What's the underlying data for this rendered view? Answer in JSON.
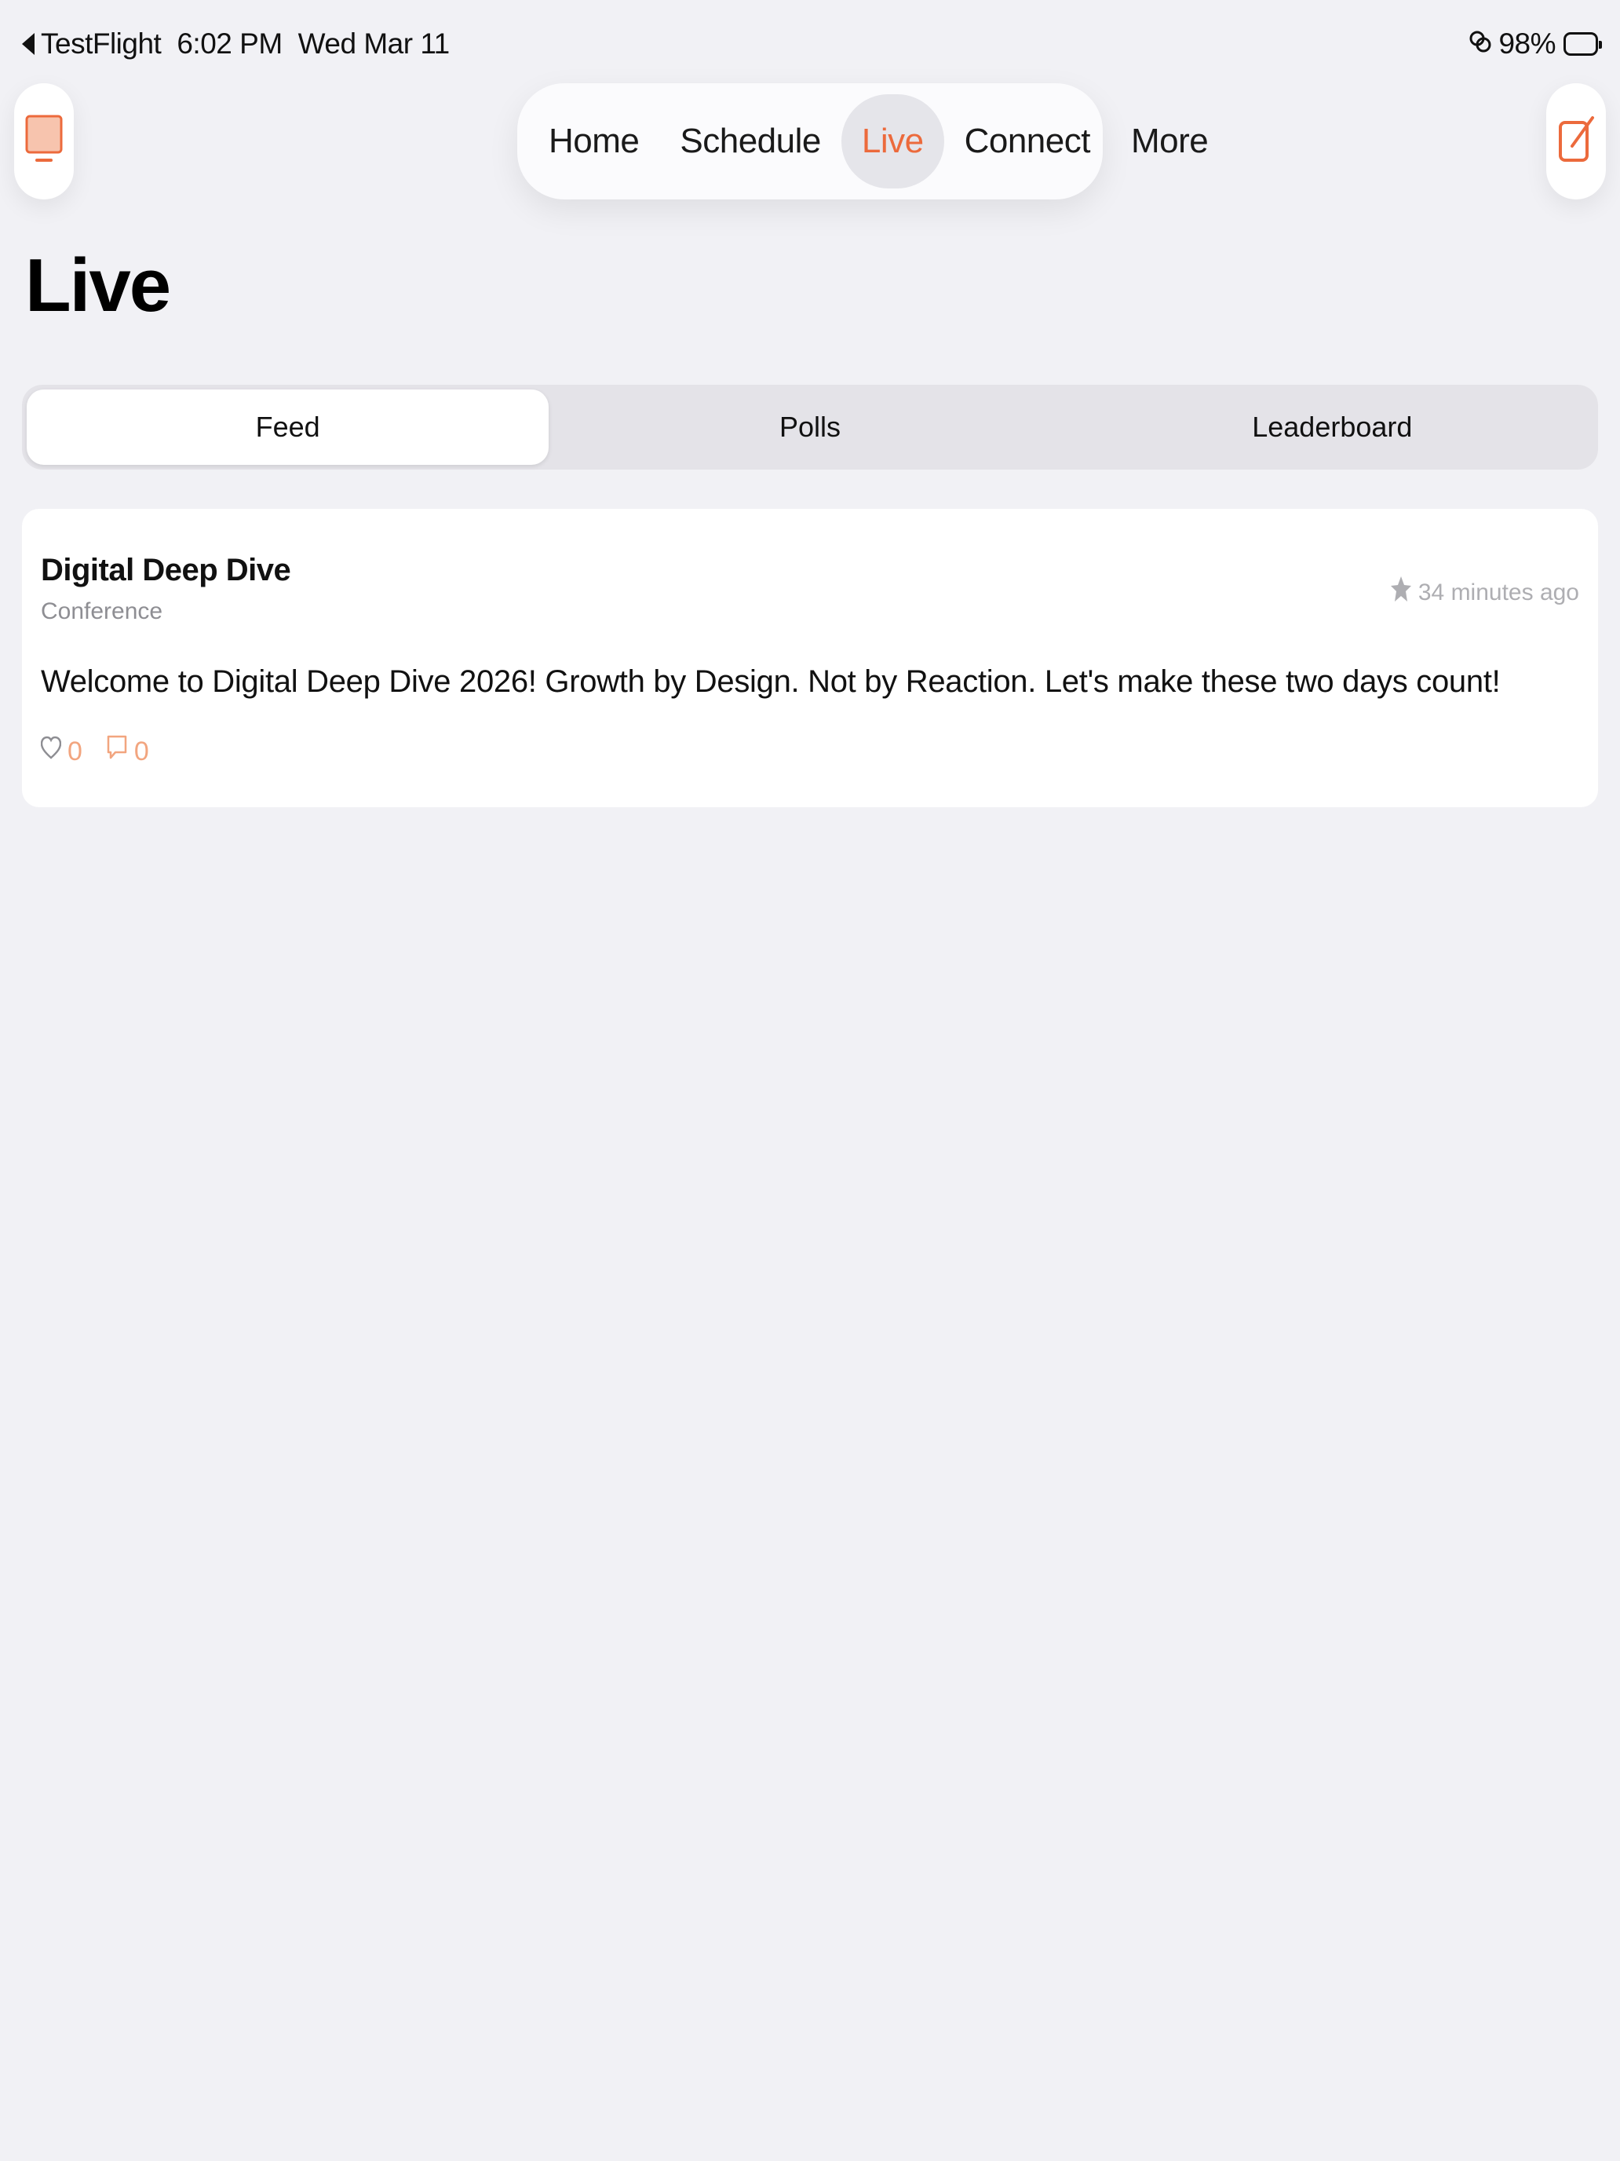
{
  "status_bar": {
    "back_app": "TestFlight",
    "time": "6:02 PM",
    "date": "Wed Mar 11",
    "battery": "98%"
  },
  "nav": {
    "tabs": [
      {
        "label": "Home"
      },
      {
        "label": "Schedule"
      },
      {
        "label": "Live"
      },
      {
        "label": "Connect"
      },
      {
        "label": "More"
      }
    ],
    "active_tab": "Live",
    "left_button_icon": "tv-icon",
    "right_button_icon": "compose-icon"
  },
  "page": {
    "title": "Live"
  },
  "segments": {
    "items": [
      {
        "label": "Feed"
      },
      {
        "label": "Polls"
      },
      {
        "label": "Leaderboard"
      }
    ],
    "selected": "Feed"
  },
  "feed": {
    "posts": [
      {
        "author": "Digital Deep Dive",
        "role": "Conference",
        "time": "34 minutes ago",
        "pinned": true,
        "body": "Welcome to Digital Deep Dive 2026! Growth by Design. Not by Reaction. Let's make these two days count!",
        "likes": "0",
        "comments": "0"
      }
    ]
  },
  "colors": {
    "accent": "#EC6A3C",
    "accent_light": "#F2A57F",
    "background": "#F1F1F5",
    "card": "#FFFFFF",
    "segment_track": "#E4E3E8",
    "secondary_text": "#8E8E93"
  }
}
